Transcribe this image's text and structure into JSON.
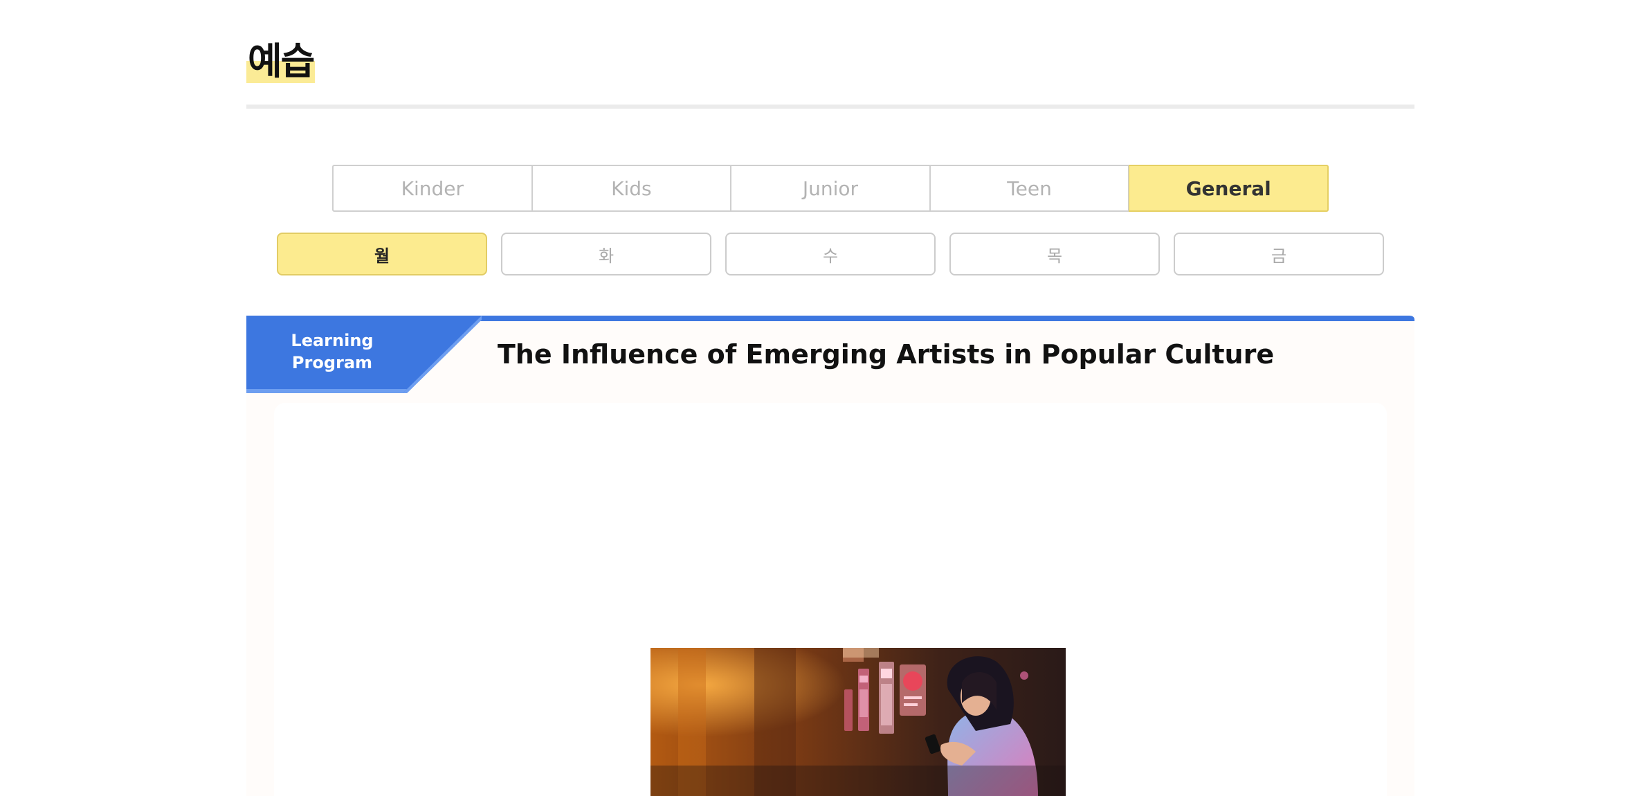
{
  "header": {
    "title": "예습"
  },
  "level_tabs": [
    {
      "label": "Kinder",
      "active": false
    },
    {
      "label": "Kids",
      "active": false
    },
    {
      "label": "Junior",
      "active": false
    },
    {
      "label": "Teen",
      "active": false
    },
    {
      "label": "General",
      "active": true
    }
  ],
  "day_tabs": [
    {
      "label": "월",
      "active": true
    },
    {
      "label": "화",
      "active": false
    },
    {
      "label": "수",
      "active": false
    },
    {
      "label": "목",
      "active": false
    },
    {
      "label": "금",
      "active": false
    }
  ],
  "lesson": {
    "badge_line1": "Learning",
    "badge_line2": "Program",
    "title": "The Influence of Emerging Artists in Popular Culture"
  },
  "colors": {
    "accent_yellow": "#fceb8f",
    "badge_blue": "#3d77e0",
    "badge_blue_light": "#6e9ef0"
  },
  "icons": {
    "lesson_image": "woman-with-phone-photo"
  }
}
